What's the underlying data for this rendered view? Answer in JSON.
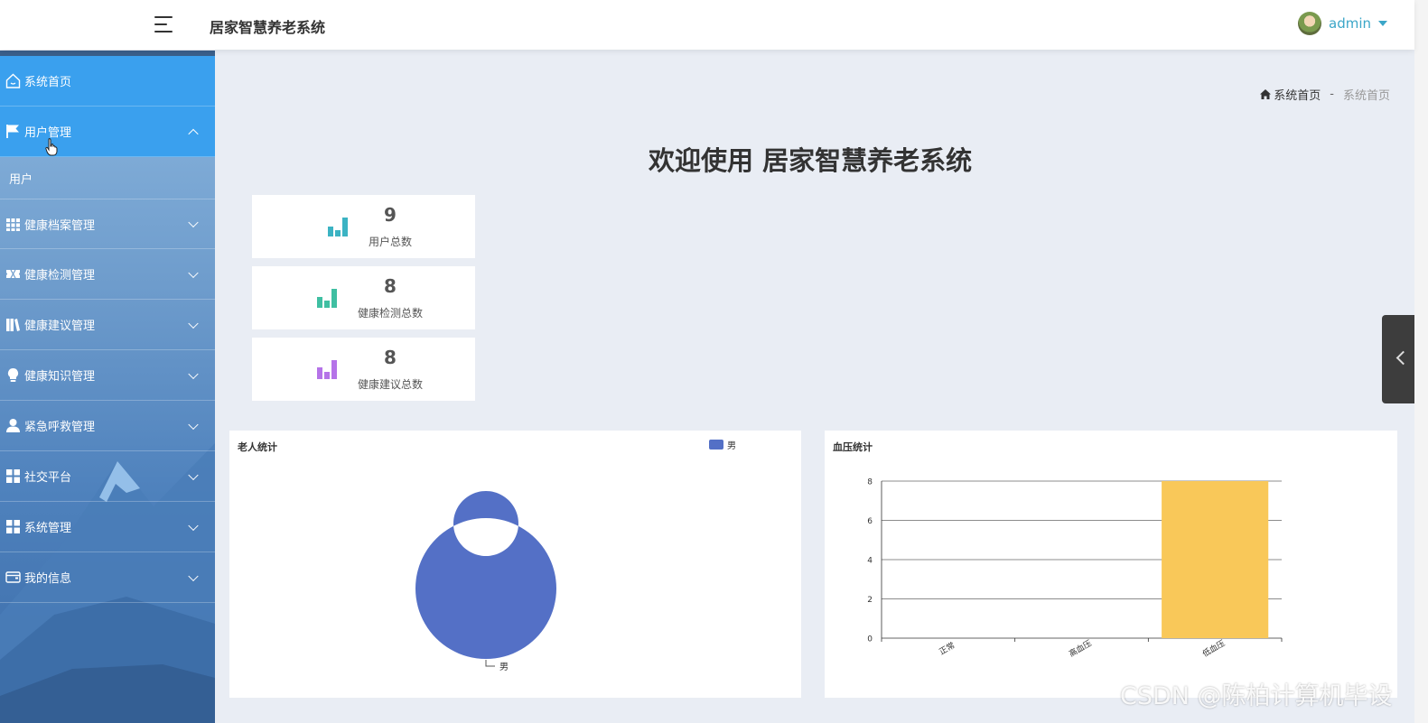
{
  "header": {
    "app_title": "居家智慧养老系统",
    "username": "admin"
  },
  "sidebar": {
    "items": [
      {
        "label": "系统首页",
        "icon": "home-icon"
      },
      {
        "label": "用户管理",
        "icon": "flag-icon",
        "expanded": true,
        "children": [
          {
            "label": "用户"
          }
        ]
      },
      {
        "label": "健康档案管理",
        "icon": "grid-icon"
      },
      {
        "label": "健康检测管理",
        "icon": "ticket-icon"
      },
      {
        "label": "健康建议管理",
        "icon": "books-icon"
      },
      {
        "label": "健康知识管理",
        "icon": "lightbulb-icon"
      },
      {
        "label": "紧急呼救管理",
        "icon": "person-icon"
      },
      {
        "label": "社交平台",
        "icon": "dashboard-icon"
      },
      {
        "label": "系统管理",
        "icon": "dashboard-icon"
      },
      {
        "label": "我的信息",
        "icon": "wallet-icon"
      }
    ]
  },
  "breadcrumb": {
    "home": "系统首页",
    "separator": "-",
    "current": "系统首页"
  },
  "welcome": "欢迎使用 居家智慧养老系统",
  "stats": [
    {
      "value": "9",
      "label": "用户总数",
      "color": "#3bb3c3"
    },
    {
      "value": "8",
      "label": "健康检测总数",
      "color": "#3fbfa2"
    },
    {
      "value": "8",
      "label": "健康建议总数",
      "color": "#b573e8"
    }
  ],
  "watermark": "CSDN @陈柏计算机毕设",
  "chart_data": [
    {
      "type": "pie",
      "title": "老人统计",
      "legend": [
        "男"
      ],
      "legend_position": "top-right",
      "slices": [
        {
          "name": "男",
          "value": 1,
          "color": "#5470c6"
        }
      ],
      "donut": true
    },
    {
      "type": "bar",
      "title": "血压统计",
      "categories": [
        "正常",
        "高血压",
        "低血压"
      ],
      "values": [
        0,
        0,
        8
      ],
      "ylim": [
        0,
        8
      ],
      "yticks": [
        0,
        2,
        4,
        6,
        8
      ],
      "grid": true,
      "bar_color": "#f9c859"
    }
  ]
}
